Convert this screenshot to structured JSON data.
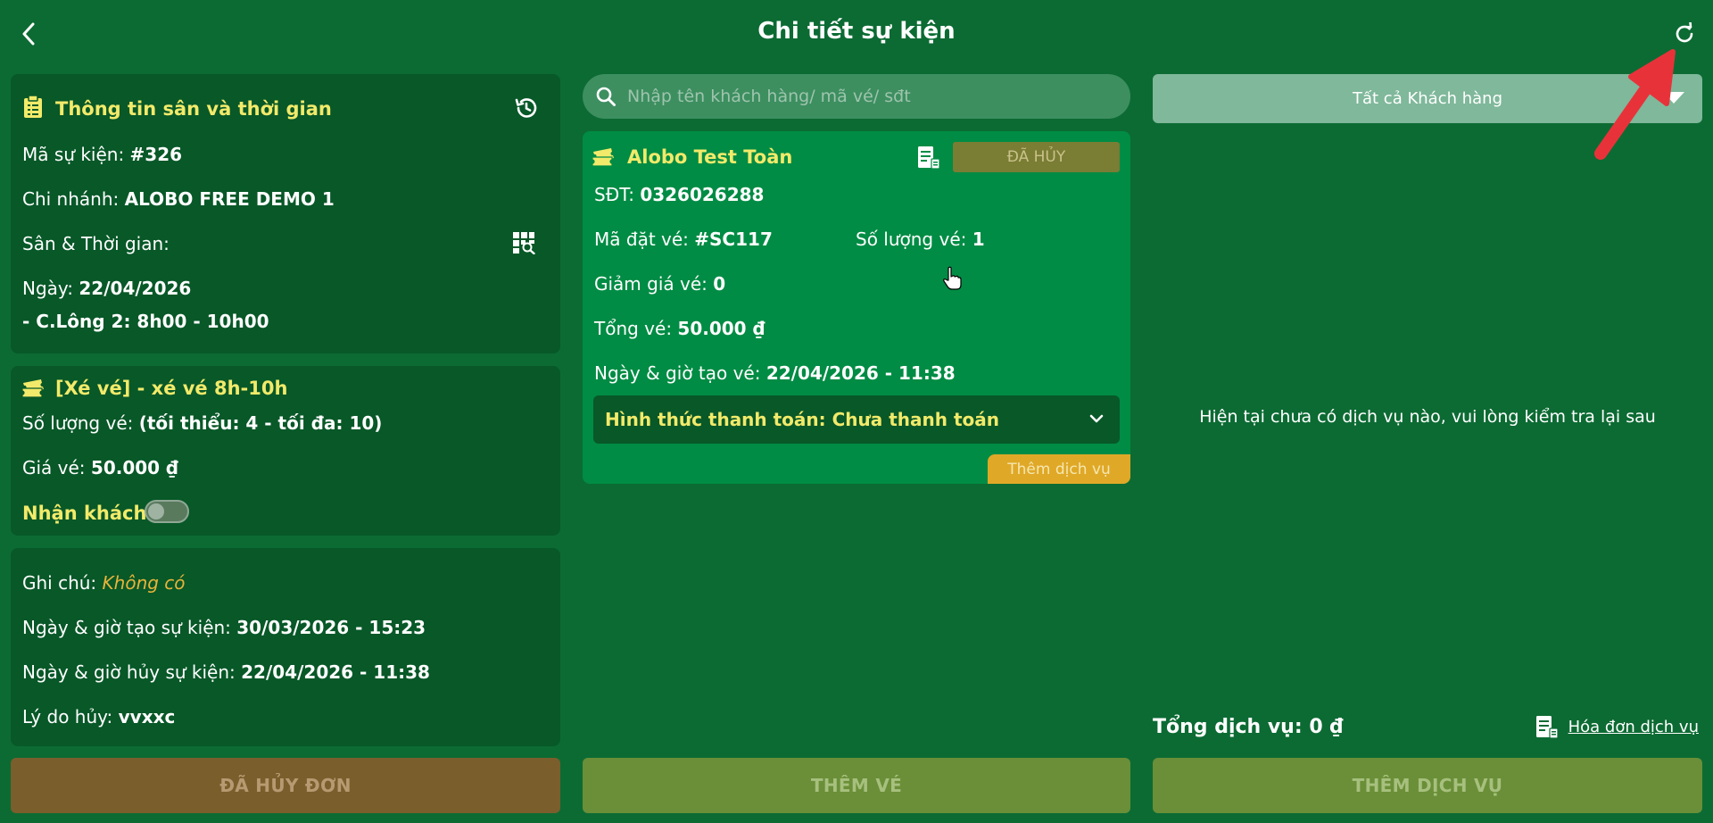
{
  "header": {
    "title": "Chi tiết sự kiện"
  },
  "left": {
    "info": {
      "heading": "Thông tin sân và thời gian",
      "event_code_label": "Mã sự kiện:",
      "event_code": "#326",
      "branch_label": "Chi nhánh:",
      "branch": "ALOBO FREE DEMO 1",
      "court_time_label": "Sân & Thời gian:",
      "date_label": "Ngày:",
      "date": "22/04/2026",
      "slot": " - C.Lông 2: 8h00 - 10h00"
    },
    "ticket": {
      "heading": "[Xé vé] - xé vé 8h-10h",
      "qty_label": "Số lượng vé:",
      "qty": "(tối thiểu: 4 - tối đa: 10)",
      "price_label": "Giá vé:",
      "price": "50.000 ₫",
      "receive_label": "Nhận khách",
      "receive_on": false
    },
    "note": {
      "note_label": "Ghi chú:",
      "note_value": "Không có",
      "created_label": "Ngày & giờ tạo sự kiện:",
      "created": "30/03/2026 - 15:23",
      "cancelled_label": "Ngày & giờ hủy sự kiện:",
      "cancelled": "22/04/2026 - 11:38",
      "reason_label": "Lý do hủy:",
      "reason": "vvxxc"
    },
    "button": "ĐÃ HỦY ĐƠN"
  },
  "middle": {
    "search_placeholder": "Nhập tên khách hàng/ mã vé/ sđt",
    "booking": {
      "name": "Alobo Test Toàn",
      "status": "ĐÃ HỦY",
      "phone_label": "SĐT:",
      "phone": "0326026288",
      "code_label": "Mã đặt vé:",
      "code": "#SC117",
      "count_label": "Số lượng vé:",
      "count": "1",
      "discount_label": "Giảm giá vé:",
      "discount": "0",
      "total_label": "Tổng vé:",
      "total": "50.000 ₫",
      "created_label": "Ngày & giờ tạo vé:",
      "created": "22/04/2026 - 11:38",
      "payment": "Hình thức thanh toán: Chưa thanh toán",
      "add_service": "Thêm dịch vụ"
    },
    "button": "THÊM VÉ"
  },
  "right": {
    "customer_filter": "Tất cả Khách hàng",
    "empty_message": "Hiện tại chưa có dịch vụ nào, vui lòng kiểm tra lại sau",
    "total_service_label": "Tổng dịch vụ:",
    "total_service": "0 ₫",
    "invoice_link": "Hóa đơn dịch vụ",
    "button": "THÊM DỊCH VỤ"
  },
  "colors": {
    "background": "#0c6b33",
    "card": "#085828",
    "booking": "#008c44",
    "accent_yellow": "#f2ea6a",
    "annotation_arrow": "#e8323a"
  }
}
